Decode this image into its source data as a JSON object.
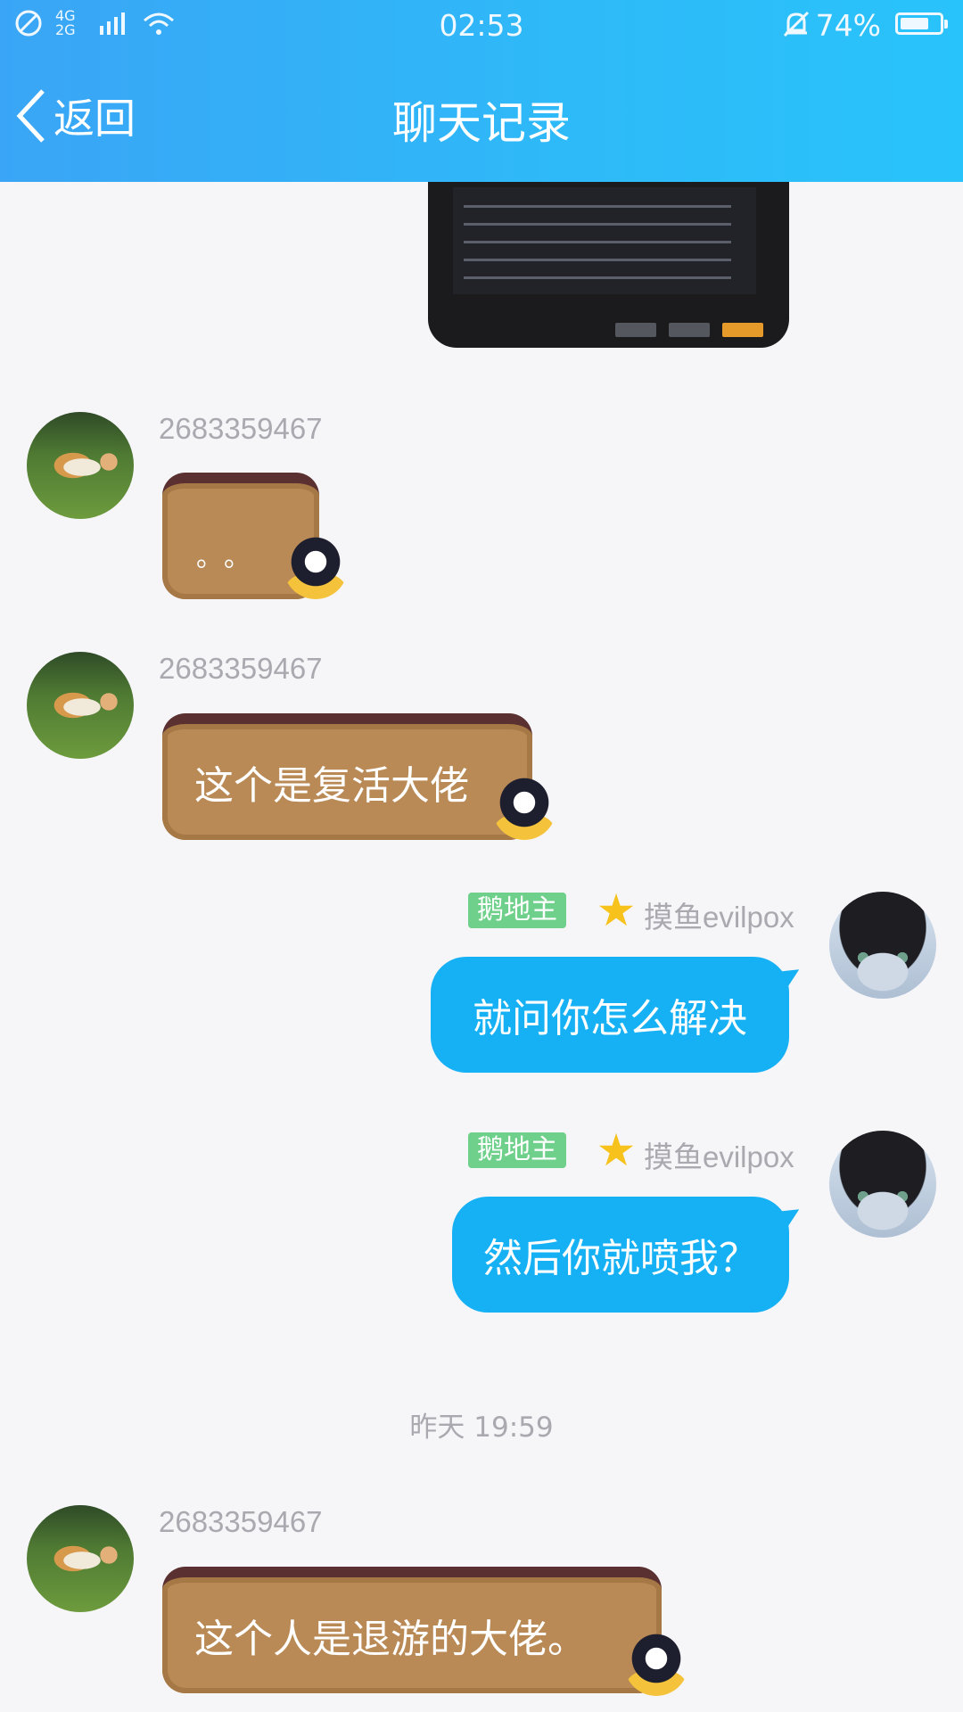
{
  "status_bar": {
    "time": "02:53",
    "network": "4G 2G",
    "battery_text": "74%",
    "battery_level": 0.74,
    "icons": [
      "no-disturb-icon",
      "signal-icon",
      "wifi-icon",
      "bell-off-icon",
      "battery-icon"
    ]
  },
  "nav": {
    "back_label": "返回",
    "title": "聊天记录"
  },
  "messages": [
    {
      "side": "left",
      "sender": "2683359467",
      "type": "sticker",
      "text": "",
      "dots": "。。"
    },
    {
      "side": "left",
      "sender": "2683359467",
      "type": "sticker",
      "text": "这个是复活大佬"
    },
    {
      "side": "right",
      "badge": "鹅地主",
      "sender": "摸鱼evilpox",
      "type": "text",
      "text": "就问你怎么解决"
    },
    {
      "side": "right",
      "badge": "鹅地主",
      "sender": "摸鱼evilpox",
      "type": "text",
      "text": "然后你就喷我？"
    },
    {
      "side": "left",
      "sender": "2683359467",
      "type": "sticker",
      "text": "这个人是退游的大佬。"
    }
  ],
  "timestamp": "昨天 19:59",
  "colors": {
    "header_start": "#3aa5f6",
    "header_end": "#29c3fb",
    "bubble_blue": "#16b1f4",
    "badge_green": "#6fd08b"
  }
}
